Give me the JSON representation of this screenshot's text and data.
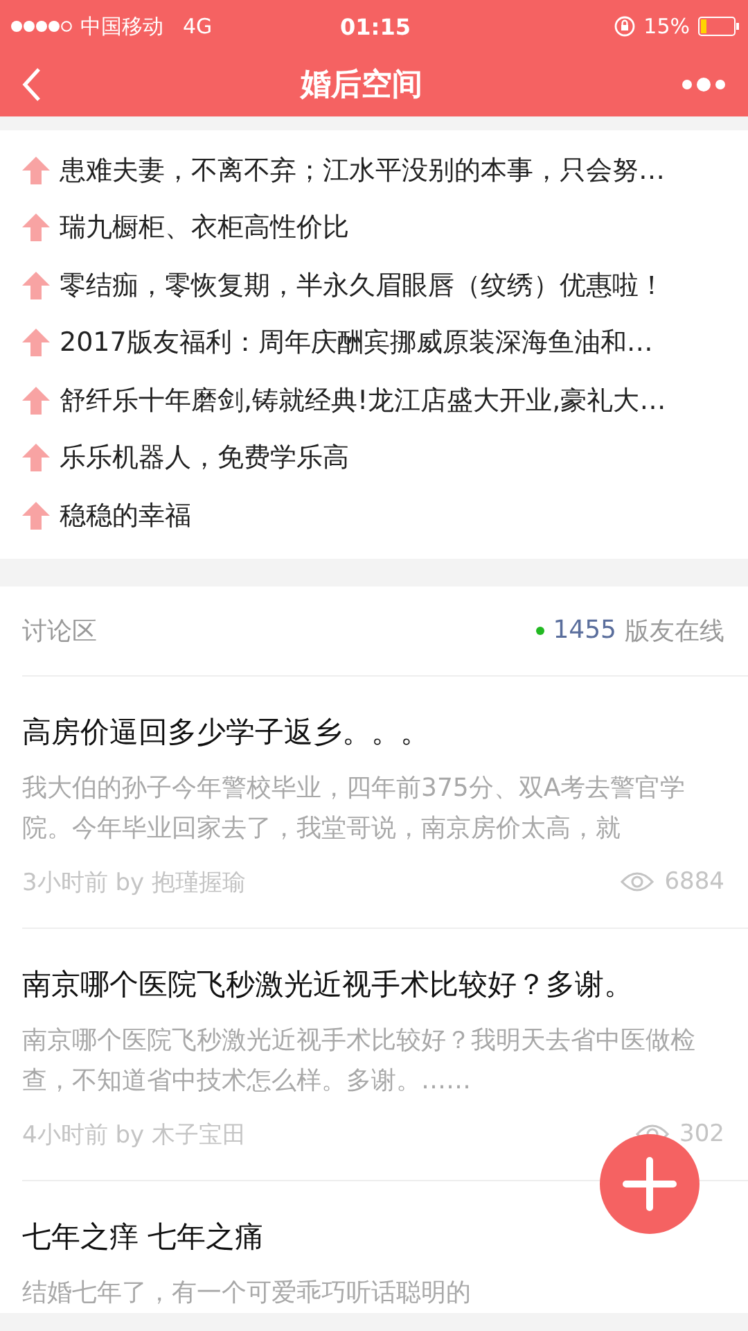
{
  "status_bar": {
    "carrier": "中国移动",
    "network": "4G",
    "time": "01:15",
    "battery": "15%"
  },
  "nav": {
    "title": "婚后空间"
  },
  "hot_topics": [
    {
      "title": "患难夫妻，不离不弃；江水平没别的本事，只会努…"
    },
    {
      "title": "瑞九橱柜、衣柜高性价比"
    },
    {
      "title": "零结痂，零恢复期，半永久眉眼唇（纹绣）优惠啦！"
    },
    {
      "title": "2017版友福利：周年庆酬宾挪威原装深海鱼油和…"
    },
    {
      "title": "舒纤乐十年磨剑,铸就经典!龙江店盛大开业,豪礼大…"
    },
    {
      "title": "乐乐机器人，免费学乐高"
    },
    {
      "title": "稳稳的幸福"
    }
  ],
  "discussion": {
    "label": "讨论区",
    "online_count": "1455",
    "online_label": "版友在线"
  },
  "posts": [
    {
      "title": "高房价逼回多少学子返乡。。。",
      "excerpt": "我大伯的孙子今年警校毕业，四年前375分、双A考去警官学院。今年毕业回家去了，我堂哥说，南京房价太高，就",
      "meta": "3小时前 by 抱瑾握瑜",
      "views": "6884"
    },
    {
      "title": "南京哪个医院飞秒激光近视手术比较好？多谢。",
      "excerpt": "南京哪个医院飞秒激光近视手术比较好？我明天去省中医做检查，不知道省中技术怎么样。多谢。……",
      "meta": "4小时前 by 木子宝田",
      "views": "302"
    },
    {
      "title": "七年之痒 七年之痛",
      "excerpt": "结婚七年了，有一个可爱乖巧听话聪明的"
    }
  ]
}
